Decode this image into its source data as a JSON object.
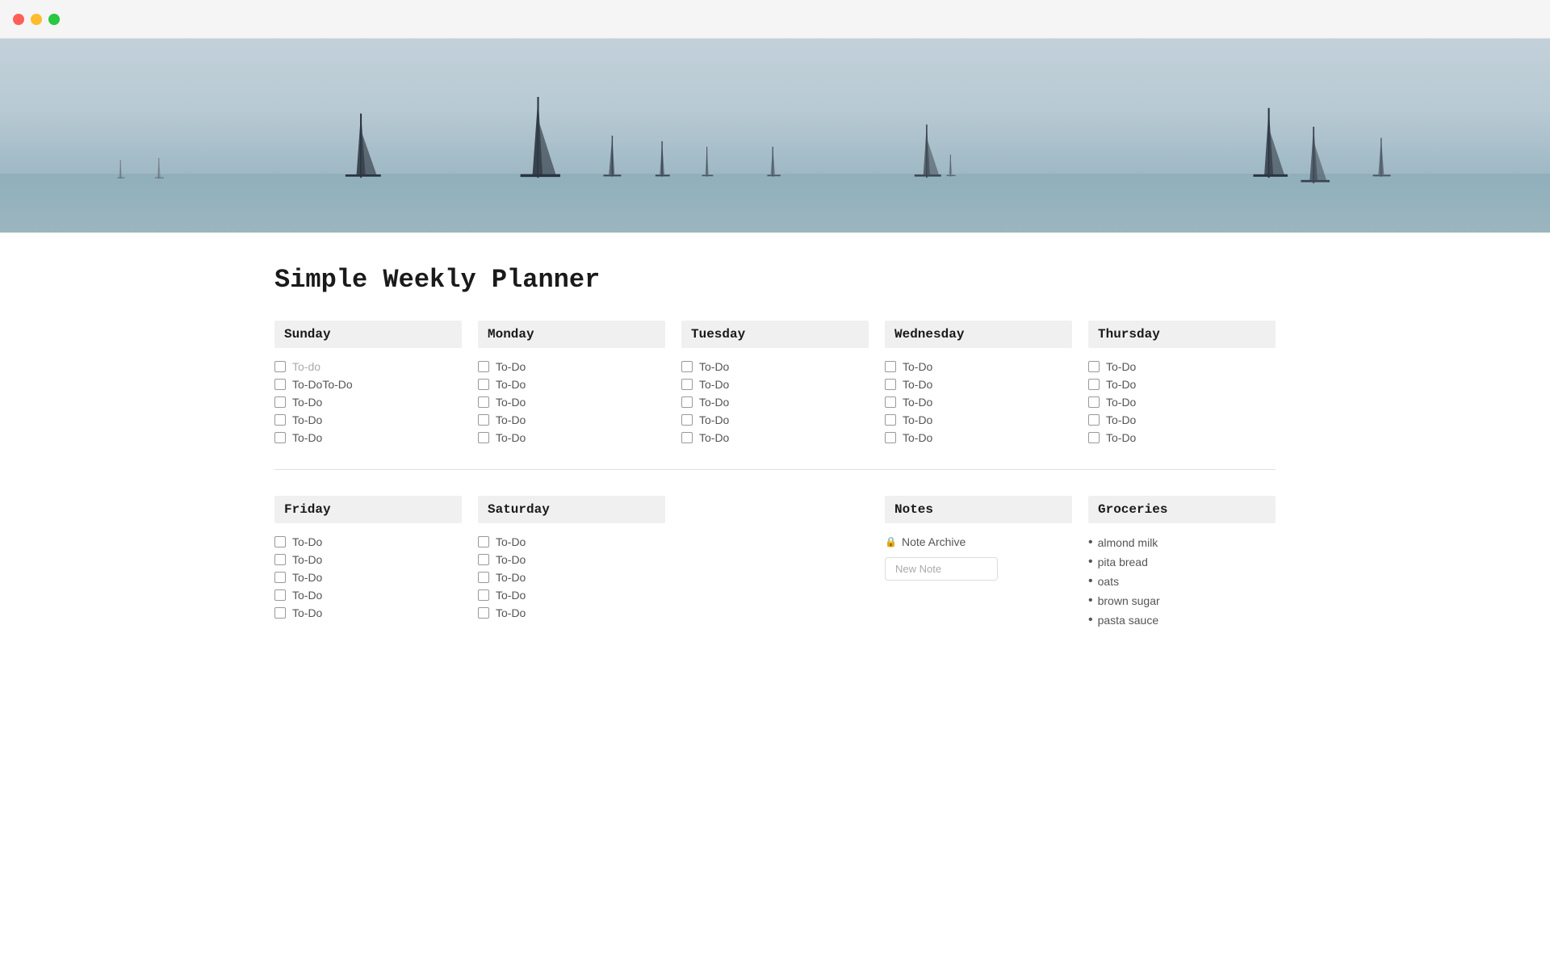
{
  "titlebar": {
    "close_color": "#ff5f57",
    "minimize_color": "#febc2e",
    "maximize_color": "#28c840"
  },
  "page": {
    "title": "Simple Weekly Planner"
  },
  "days_top": [
    {
      "name": "Sunday",
      "items": [
        {
          "label": "To-do",
          "placeholder": true
        },
        {
          "label": "To-DoTo-Do",
          "placeholder": false
        },
        {
          "label": "To-Do",
          "placeholder": false
        },
        {
          "label": "To-Do",
          "placeholder": false
        },
        {
          "label": "To-Do",
          "placeholder": false
        }
      ]
    },
    {
      "name": "Monday",
      "items": [
        {
          "label": "To-Do",
          "placeholder": false
        },
        {
          "label": "To-Do",
          "placeholder": false
        },
        {
          "label": "To-Do",
          "placeholder": false
        },
        {
          "label": "To-Do",
          "placeholder": false
        },
        {
          "label": "To-Do",
          "placeholder": false
        }
      ]
    },
    {
      "name": "Tuesday",
      "items": [
        {
          "label": "To-Do",
          "placeholder": false
        },
        {
          "label": "To-Do",
          "placeholder": false
        },
        {
          "label": "To-Do",
          "placeholder": false
        },
        {
          "label": "To-Do",
          "placeholder": false
        },
        {
          "label": "To-Do",
          "placeholder": false
        }
      ]
    },
    {
      "name": "Wednesday",
      "items": [
        {
          "label": "To-Do",
          "placeholder": false
        },
        {
          "label": "To-Do",
          "placeholder": false
        },
        {
          "label": "To-Do",
          "placeholder": false
        },
        {
          "label": "To-Do",
          "placeholder": false
        },
        {
          "label": "To-Do",
          "placeholder": false
        }
      ]
    },
    {
      "name": "Thursday",
      "items": [
        {
          "label": "To-Do",
          "placeholder": false
        },
        {
          "label": "To-Do",
          "placeholder": false
        },
        {
          "label": "To-Do",
          "placeholder": false
        },
        {
          "label": "To-Do",
          "placeholder": false
        },
        {
          "label": "To-Do",
          "placeholder": false
        }
      ]
    }
  ],
  "days_bottom_left": [
    {
      "name": "Friday",
      "items": [
        {
          "label": "To-Do"
        },
        {
          "label": "To-Do"
        },
        {
          "label": "To-Do"
        },
        {
          "label": "To-Do"
        },
        {
          "label": "To-Do"
        }
      ]
    },
    {
      "name": "Saturday",
      "items": [
        {
          "label": "To-Do"
        },
        {
          "label": "To-Do"
        },
        {
          "label": "To-Do"
        },
        {
          "label": "To-Do"
        },
        {
          "label": "To-Do"
        }
      ]
    }
  ],
  "notes": {
    "header": "Notes",
    "archive_label": "Note Archive",
    "new_note_placeholder": "New Note"
  },
  "groceries": {
    "header": "Groceries",
    "items": [
      "almond milk",
      "pita bread",
      "oats",
      "brown sugar",
      "pasta sauce"
    ]
  }
}
